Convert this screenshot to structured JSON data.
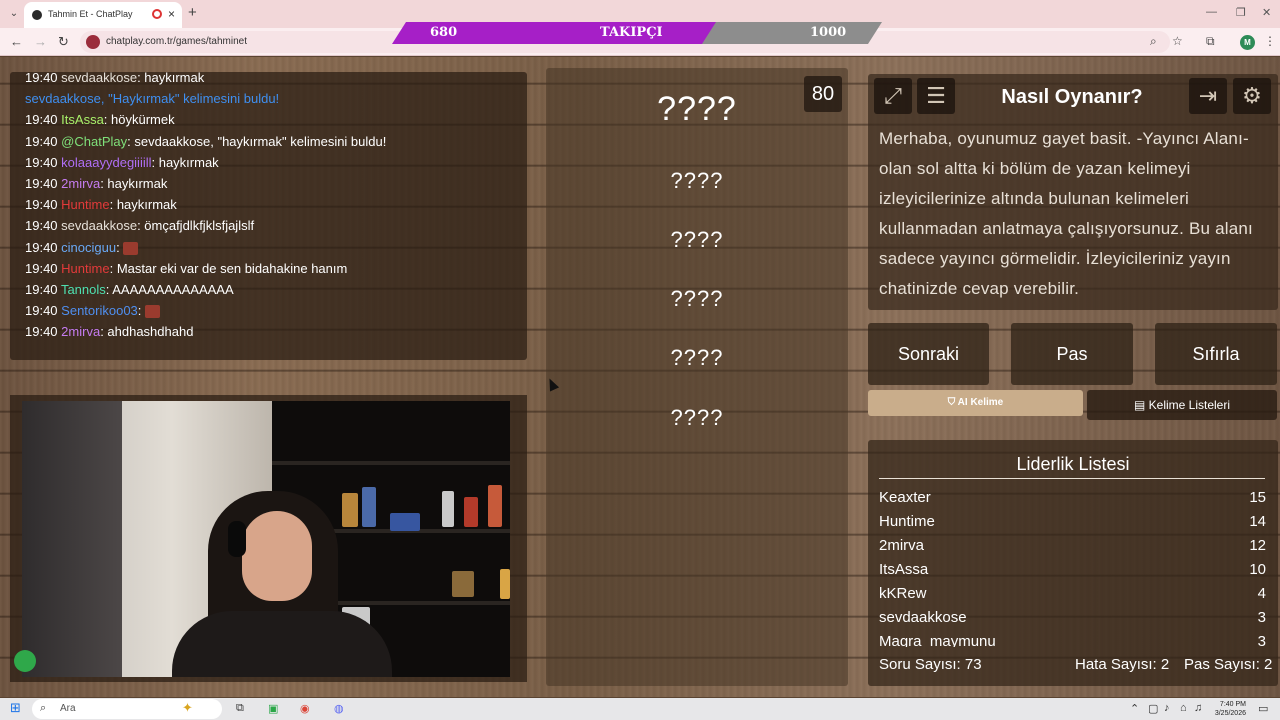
{
  "browser": {
    "tab_title": "Tahmin Et - ChatPlay",
    "url": "chatplay.com.tr/games/tahminet",
    "profile_initial": "M"
  },
  "followers": {
    "current": "680",
    "label": "TAKIPÇI",
    "goal": "1000",
    "progress": 0.68
  },
  "chat": {
    "messages": [
      {
        "time": "19:40",
        "user": "sevdaakkose",
        "user_color": "#e6e0d8",
        "text": ": haykırmak"
      },
      {
        "time": "",
        "user": "sevdaakkose, \"Haykırmak\" kelimesini buldu!",
        "user_color": "#3f8ff0",
        "text": ""
      },
      {
        "time": "19:40",
        "user": "ItsAssa",
        "user_color": "#a8f06a",
        "text": ": höykürmek"
      },
      {
        "time": "19:40",
        "user": "@ChatPlay",
        "user_color": "#7fe07a",
        "text": ": sevdaakkose, \"haykırmak\" kelimesini buldu!"
      },
      {
        "time": "19:40",
        "user": "kolaaayydegiiiill",
        "user_color": "#b06ff5",
        "text": ": haykırmak"
      },
      {
        "time": "19:40",
        "user": "2mirva",
        "user_color": "#c57cf0",
        "text": ": haykırmak"
      },
      {
        "time": "19:40",
        "user": "Huntime",
        "user_color": "#e23a3a",
        "text": ": haykırmak"
      },
      {
        "time": "19:40",
        "user": "sevdaakkose",
        "user_color": "#e6e0d8",
        "text": ": ömçafjdlkfjklsfjajlslf"
      },
      {
        "time": "19:40",
        "user": "cinociguu",
        "user_color": "#6aa9f5",
        "text": ":"
      },
      {
        "time": "19:40",
        "user": "Huntime",
        "user_color": "#e23a3a",
        "text": ": Mastar eki var de sen bidahakine hanım"
      },
      {
        "time": "19:40",
        "user": "Tannols",
        "user_color": "#4fe0b0",
        "text": ": AAAAAAAAAAAAAA"
      },
      {
        "time": "19:40",
        "user": "Sentorikoo03",
        "user_color": "#4f8ff0",
        "text": ":"
      },
      {
        "time": "19:40",
        "user": "2mirva",
        "user_color": "#c57cf0",
        "text": ": ahdhashdhahd"
      }
    ]
  },
  "game": {
    "timer": "80",
    "words": [
      "????",
      "????",
      "????",
      "????",
      "????",
      "????"
    ]
  },
  "howto": {
    "title": "Nasıl Oynanır?",
    "text": "Merhaba, oyunumuz gayet basit. -Yayıncı Alanı- olan sol altta ki bölüm de yazan kelimeyi izleyicilerinize altında bulunan kelimeleri kullanmadan anlatmaya çalışıyorsunuz. Bu alanı sadece yayıncı görmelidir. İzleyicileriniz yayın chatinizde cevap verebilir."
  },
  "controls": {
    "next": "Sonraki",
    "pass": "Pas",
    "reset": "Sıfırla",
    "ai_word": "AI Kelime",
    "word_lists": "Kelime Listeleri"
  },
  "leaderboard": {
    "title": "Liderlik Listesi",
    "rows": [
      {
        "name": "Keaxter",
        "score": "15"
      },
      {
        "name": "Huntime",
        "score": "14"
      },
      {
        "name": "2mirva",
        "score": "12"
      },
      {
        "name": "ItsAssa",
        "score": "10"
      },
      {
        "name": "kKRew",
        "score": "4"
      },
      {
        "name": "sevdaakkose",
        "score": "3"
      },
      {
        "name": "Magra_maymunu",
        "score": "3"
      }
    ],
    "question_count": "Soru Sayısı: 73",
    "error_count": "Hata Sayısı: 2",
    "pass_count": "Pas Sayısı: 2"
  },
  "taskbar": {
    "search_placeholder": "Ara",
    "time": "7:40 PM",
    "date": "3/25/2026"
  }
}
